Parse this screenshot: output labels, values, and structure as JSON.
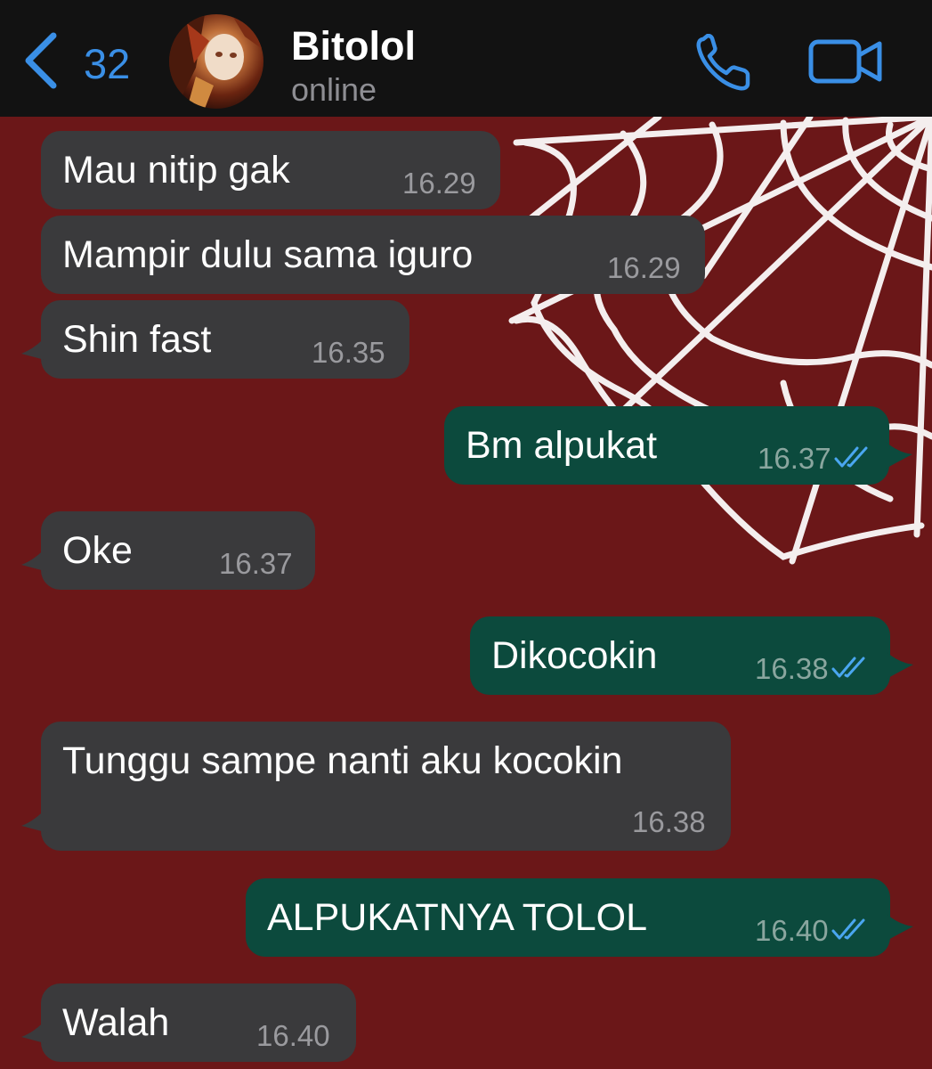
{
  "header": {
    "back_icon": "chevron-left-icon",
    "back_count": "32",
    "contact_name": "Bitolol",
    "contact_status": "online",
    "call_icon": "phone-icon",
    "video_icon": "video-camera-icon",
    "accent_color": "#3a8fe6"
  },
  "chat": {
    "background_color": "#6b1718",
    "incoming_color": "#3a3a3c",
    "outgoing_color": "#0c4a3d",
    "messages": [
      {
        "direction": "in",
        "text": "Mau nitip gak",
        "time": "16.29"
      },
      {
        "direction": "in",
        "text": "Mampir dulu sama iguro",
        "time": "16.29"
      },
      {
        "direction": "in",
        "text": "Shin fast",
        "time": "16.35"
      },
      {
        "direction": "out",
        "text": "Bm alpukat",
        "time": "16.37",
        "status": "read"
      },
      {
        "direction": "in",
        "text": "Oke",
        "time": "16.37"
      },
      {
        "direction": "out",
        "text": "Dikocokin",
        "time": "16.38",
        "status": "read"
      },
      {
        "direction": "in",
        "text": "Tunggu sampe nanti aku kocokin",
        "time": "16.38"
      },
      {
        "direction": "out",
        "text": "ALPUKATNYA TOLOL",
        "time": "16.40",
        "status": "read"
      },
      {
        "direction": "in",
        "text": "Walah",
        "time": "16.40"
      }
    ]
  }
}
